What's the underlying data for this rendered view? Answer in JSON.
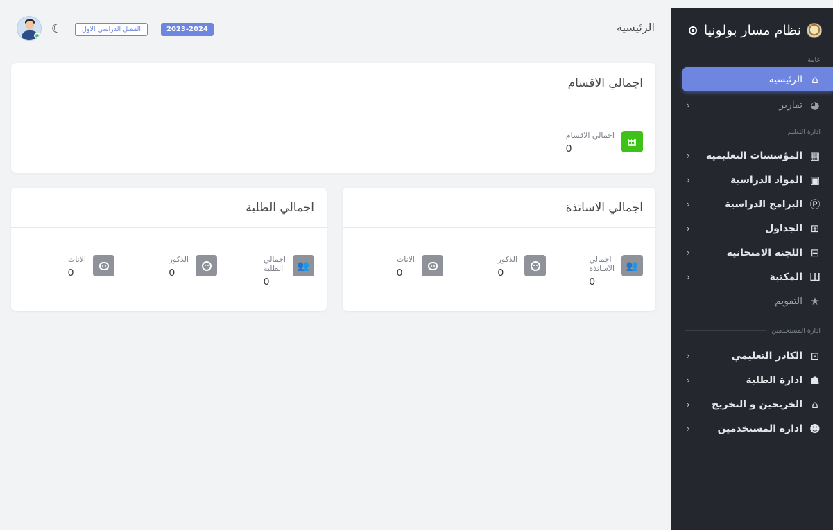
{
  "sidebar": {
    "brand": "نظام مسار بولونيا",
    "sections": [
      {
        "label": "عامة"
      },
      {
        "label": "ادارة التعليم"
      },
      {
        "label": "ادارة المستخدمين"
      }
    ],
    "items": [
      {
        "label": "الرئيسية",
        "icon": "home-icon"
      },
      {
        "label": "تقارير",
        "icon": "pie-chart-icon"
      },
      {
        "label": "المؤسسات التعليمية",
        "icon": "building-icon"
      },
      {
        "label": "المواد الدراسية",
        "icon": "book-gear-icon"
      },
      {
        "label": "البرامج الدراسية",
        "icon": "programs-icon"
      },
      {
        "label": "الجداول",
        "icon": "table-gear-icon"
      },
      {
        "label": "اللجنة الامتحانية",
        "icon": "exam-committee-icon"
      },
      {
        "label": "المكتبة",
        "icon": "library-icon"
      },
      {
        "label": "التقويم",
        "icon": "star-icon"
      },
      {
        "label": "الكادر التعليمي",
        "icon": "teacher-board-icon"
      },
      {
        "label": "ادارة الطلبة",
        "icon": "students-icon"
      },
      {
        "label": "الخريجين و التخريج",
        "icon": "graduation-cap-icon"
      },
      {
        "label": "ادارة المستخدمين",
        "icon": "user-search-icon"
      }
    ]
  },
  "header": {
    "title": "الرئيسية",
    "year": "2023-2024",
    "semester": "الفصل الدراسي الاول"
  },
  "departments_card": {
    "title": "اجمالي الاقسام",
    "stat_label": "اجمالي الاقسام",
    "stat_value": "0"
  },
  "teachers_card": {
    "title": "اجمالي الاساتذة",
    "total_label_line1": "اجمالي",
    "total_label_line2": "الاساتذة",
    "total_value": "0",
    "male_label": "الذكور",
    "male_value": "0",
    "female_label": "الاناث",
    "female_value": "0"
  },
  "students_card": {
    "title": "اجمالي الطلبة",
    "total_label_line1": "اجمالي",
    "total_label_line2": "الطلبة",
    "total_value": "0",
    "male_label": "الذكور",
    "male_value": "0",
    "female_label": "الاناث",
    "female_value": "0"
  },
  "colors": {
    "accent": "#6e86e0",
    "sidebar_bg": "#24272e",
    "green": "#3fc218",
    "stat_gray": "#8f9399"
  }
}
